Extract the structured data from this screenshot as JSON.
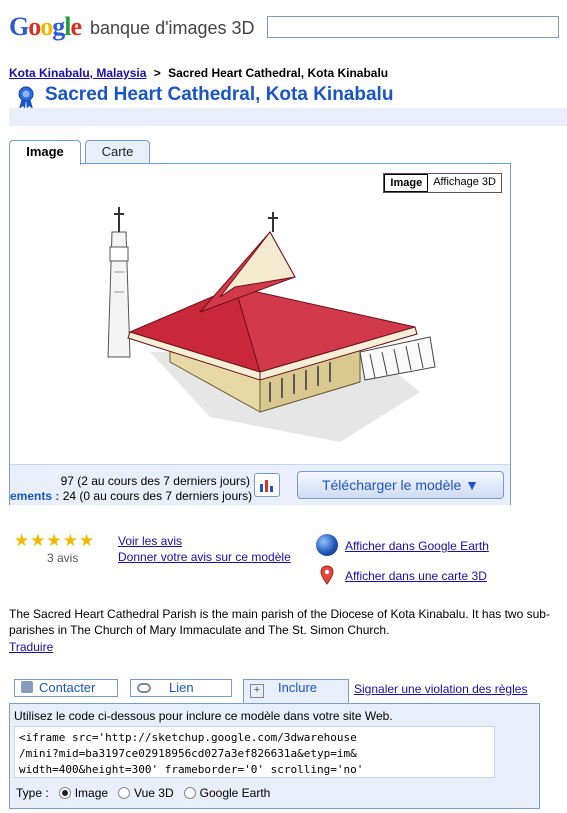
{
  "header": {
    "logo_letters": [
      "G",
      "o",
      "o",
      "g",
      "l",
      "e"
    ],
    "logo_colors": [
      "#2a5bd7",
      "#d93025",
      "#f2b600",
      "#2a5bd7",
      "#1e9e3f",
      "#d93025"
    ],
    "subtitle": "banque d'images 3D",
    "search_placeholder": ""
  },
  "breadcrumb": {
    "parent": "Kota Kinabalu, Malaysia",
    "separator": ">",
    "current": "Sacred Heart Cathedral, Kota Kinabalu"
  },
  "title": "Sacred Heart Cathedral, Kota Kinabalu",
  "tabs": [
    {
      "label": "Image",
      "active": true
    },
    {
      "label": "Carte",
      "active": false
    }
  ],
  "viewer": {
    "toggle": [
      "Image",
      "Affichage 3D"
    ],
    "stat_views": "97 (2 au cours des 7 derniers jours)",
    "stat_downloads_label": "ements :",
    "stat_downloads": "24 (0 au cours des 7 derniers jours)",
    "download_label": "Télécharger le modèle ▼"
  },
  "rating": {
    "stars": "★★★★★",
    "count": "3 avis",
    "link_reviews": "Voir les avis",
    "link_give_review": "Donner votre avis sur ce modèle"
  },
  "actions_right": {
    "earth": "Afficher dans Google Earth",
    "map3d": "Afficher dans une carte 3D"
  },
  "description": {
    "text": "The Sacred Heart Cathedral Parish is the main parish of the Diocese of Kota Kinabalu. It has two sub-parishes in The Church of Mary Immaculate and The St. Simon Church.",
    "translate": "Traduire"
  },
  "action_row": {
    "contact": "Contacter",
    "link": "Lien",
    "embed": "Inclure",
    "report": "Signaler une violation des règles"
  },
  "embed": {
    "intro": "Utilisez le code ci-dessous pour inclure ce modèle dans votre site Web.",
    "code": "<iframe src='http://sketchup.google.com/3dwarehouse\n/mini?mid=ba3197ce02918956cd027a3ef826631a&etyp=im&\nwidth=400&height=300' frameborder='0' scrolling='no'",
    "type_label": "Type :",
    "options": [
      "Image",
      "Vue 3D",
      "Google Earth"
    ],
    "selected": "Image"
  },
  "colors": {
    "link": "#1a0dab",
    "accent": "#1a55c8",
    "panel": "#e8eefa",
    "roof": "#c8283a"
  }
}
